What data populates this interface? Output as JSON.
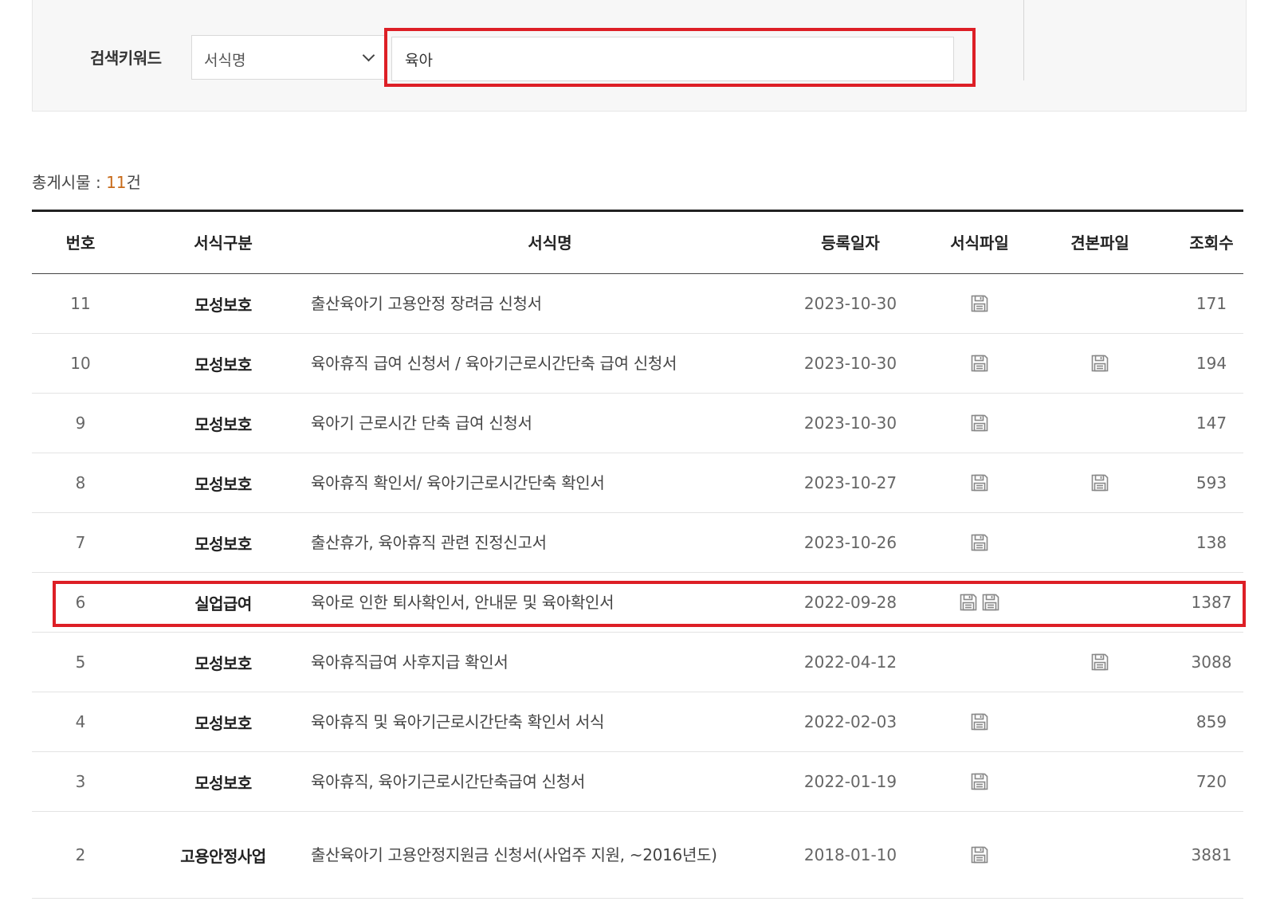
{
  "search": {
    "label": "검색키워드",
    "select_value": "서식명",
    "input_value": "육아"
  },
  "total": {
    "prefix": "총게시물 : ",
    "count": "11",
    "suffix": "건"
  },
  "table": {
    "headers": {
      "no": "번호",
      "category": "서식구분",
      "title": "서식명",
      "date": "등록일자",
      "form_file": "서식파일",
      "sample_file": "견본파일",
      "views": "조회수"
    },
    "rows": [
      {
        "no": "11",
        "category": "모성보호",
        "title": "출산육아기 고용안정 장려금 신청서",
        "date": "2023-10-30",
        "form_files": 1,
        "sample_files": 0,
        "views": "171"
      },
      {
        "no": "10",
        "category": "모성보호",
        "title": "육아휴직 급여 신청서 / 육아기근로시간단축 급여 신청서",
        "date": "2023-10-30",
        "form_files": 1,
        "sample_files": 1,
        "views": "194"
      },
      {
        "no": "9",
        "category": "모성보호",
        "title": "육아기 근로시간 단축 급여 신청서",
        "date": "2023-10-30",
        "form_files": 1,
        "sample_files": 0,
        "views": "147"
      },
      {
        "no": "8",
        "category": "모성보호",
        "title": "육아휴직 확인서/ 육아기근로시간단축 확인서",
        "date": "2023-10-27",
        "form_files": 1,
        "sample_files": 1,
        "views": "593"
      },
      {
        "no": "7",
        "category": "모성보호",
        "title": "출산휴가, 육아휴직 관련 진정신고서",
        "date": "2023-10-26",
        "form_files": 1,
        "sample_files": 0,
        "views": "138"
      },
      {
        "no": "6",
        "category": "실업급여",
        "title": "육아로 인한 퇴사확인서, 안내문 및 육아확인서",
        "date": "2022-09-28",
        "form_files": 2,
        "sample_files": 0,
        "views": "1387"
      },
      {
        "no": "5",
        "category": "모성보호",
        "title": "육아휴직급여 사후지급 확인서",
        "date": "2022-04-12",
        "form_files": 0,
        "sample_files": 1,
        "views": "3088"
      },
      {
        "no": "4",
        "category": "모성보호",
        "title": "육아휴직 및 육아기근로시간단축 확인서 서식",
        "date": "2022-02-03",
        "form_files": 1,
        "sample_files": 0,
        "views": "859"
      },
      {
        "no": "3",
        "category": "모성보호",
        "title": "육아휴직, 육아기근로시간단축급여 신청서",
        "date": "2022-01-19",
        "form_files": 1,
        "sample_files": 0,
        "views": "720"
      },
      {
        "no": "2",
        "category": "고용안정사업",
        "title": "출산육아기 고용안정지원금 신청서(사업주 지원, ~2016년도)",
        "date": "2018-01-10",
        "form_files": 1,
        "sample_files": 0,
        "views": "3881"
      }
    ]
  },
  "icons": {
    "file": "floppy-disk-icon"
  },
  "colors": {
    "highlight": "#dd1f26",
    "count_accent": "#c86b1a"
  }
}
